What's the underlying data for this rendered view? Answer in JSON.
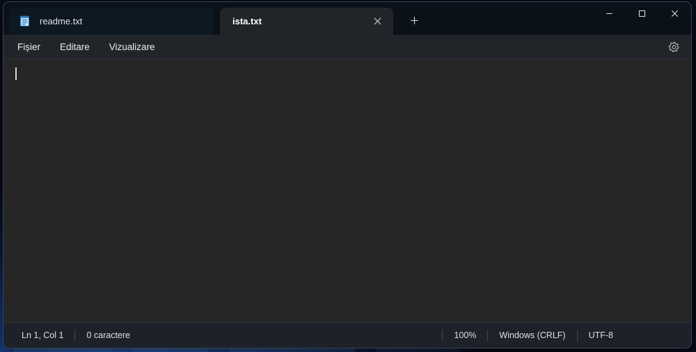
{
  "window": {
    "app_name": "Notepad",
    "controls": {
      "minimize_label": "Minimizare",
      "maximize_label": "Maximizare",
      "close_label": "Închidere"
    }
  },
  "tabs": {
    "items": [
      {
        "label": "readme.txt",
        "active": false,
        "icon": "notepad-document-icon"
      },
      {
        "label": "ista.txt",
        "active": true,
        "icon": "notepad-document-icon"
      }
    ],
    "close_glyph": "✕",
    "new_tab_glyph": "+",
    "new_tab_label": "Filă nouă"
  },
  "menu": {
    "items": [
      {
        "label": "Fișier"
      },
      {
        "label": "Editare"
      },
      {
        "label": "Vizualizare"
      }
    ],
    "settings_icon": "gear-icon"
  },
  "editor": {
    "content": "",
    "placeholder": ""
  },
  "statusbar": {
    "left": [
      {
        "label": "Ln 1, Col 1"
      },
      {
        "label": "0 caractere"
      }
    ],
    "right": [
      {
        "label": "100%"
      },
      {
        "label": "Windows (CRLF)"
      },
      {
        "label": "UTF-8"
      }
    ]
  },
  "colors": {
    "titlebar_bg": "#0a1119",
    "tab_active_bg": "#212529",
    "tab_inactive_bg": "#0e1822",
    "menubar_bg": "#212529",
    "editor_bg": "#262626",
    "statusbar_bg": "#1d2129",
    "text_primary": "#eceff2",
    "accent_icon": "#4ea6e8"
  }
}
